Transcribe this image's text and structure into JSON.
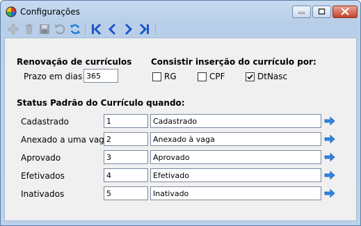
{
  "window": {
    "title": "Configurações"
  },
  "renovacao": {
    "heading": "Renovação de currículos",
    "prazo_label": "Prazo em dias",
    "prazo_value": "365"
  },
  "consistir": {
    "heading": "Consistir inserção do currículo por:",
    "options": [
      {
        "label": "RG",
        "checked": false
      },
      {
        "label": "CPF",
        "checked": false
      },
      {
        "label": "DtNasc",
        "checked": true
      }
    ]
  },
  "status": {
    "heading": "Status Padrão do Currículo quando:",
    "rows": [
      {
        "label": "Cadastrado",
        "code": "1",
        "name": "Cadastrado"
      },
      {
        "label": "Anexado a uma vaga",
        "code": "2",
        "name": "Anexado à vaga"
      },
      {
        "label": "Aprovado",
        "code": "3",
        "name": "Aprovado"
      },
      {
        "label": "Efetivados",
        "code": "4",
        "name": "Efetivado"
      },
      {
        "label": "Inativados",
        "code": "5",
        "name": "Inativado"
      }
    ]
  },
  "icons": {
    "toolbar": [
      "add-icon",
      "delete-icon",
      "save-icon",
      "undo-icon",
      "refresh-icon",
      "first-record-icon",
      "previous-record-icon",
      "next-record-icon",
      "last-record-icon"
    ],
    "row_action": "arrow-right-icon"
  },
  "colors": {
    "nav_blue": "#1a56c9",
    "arrow_blue": "#2f86e6",
    "disabled_gray": "#9aa3ad"
  }
}
